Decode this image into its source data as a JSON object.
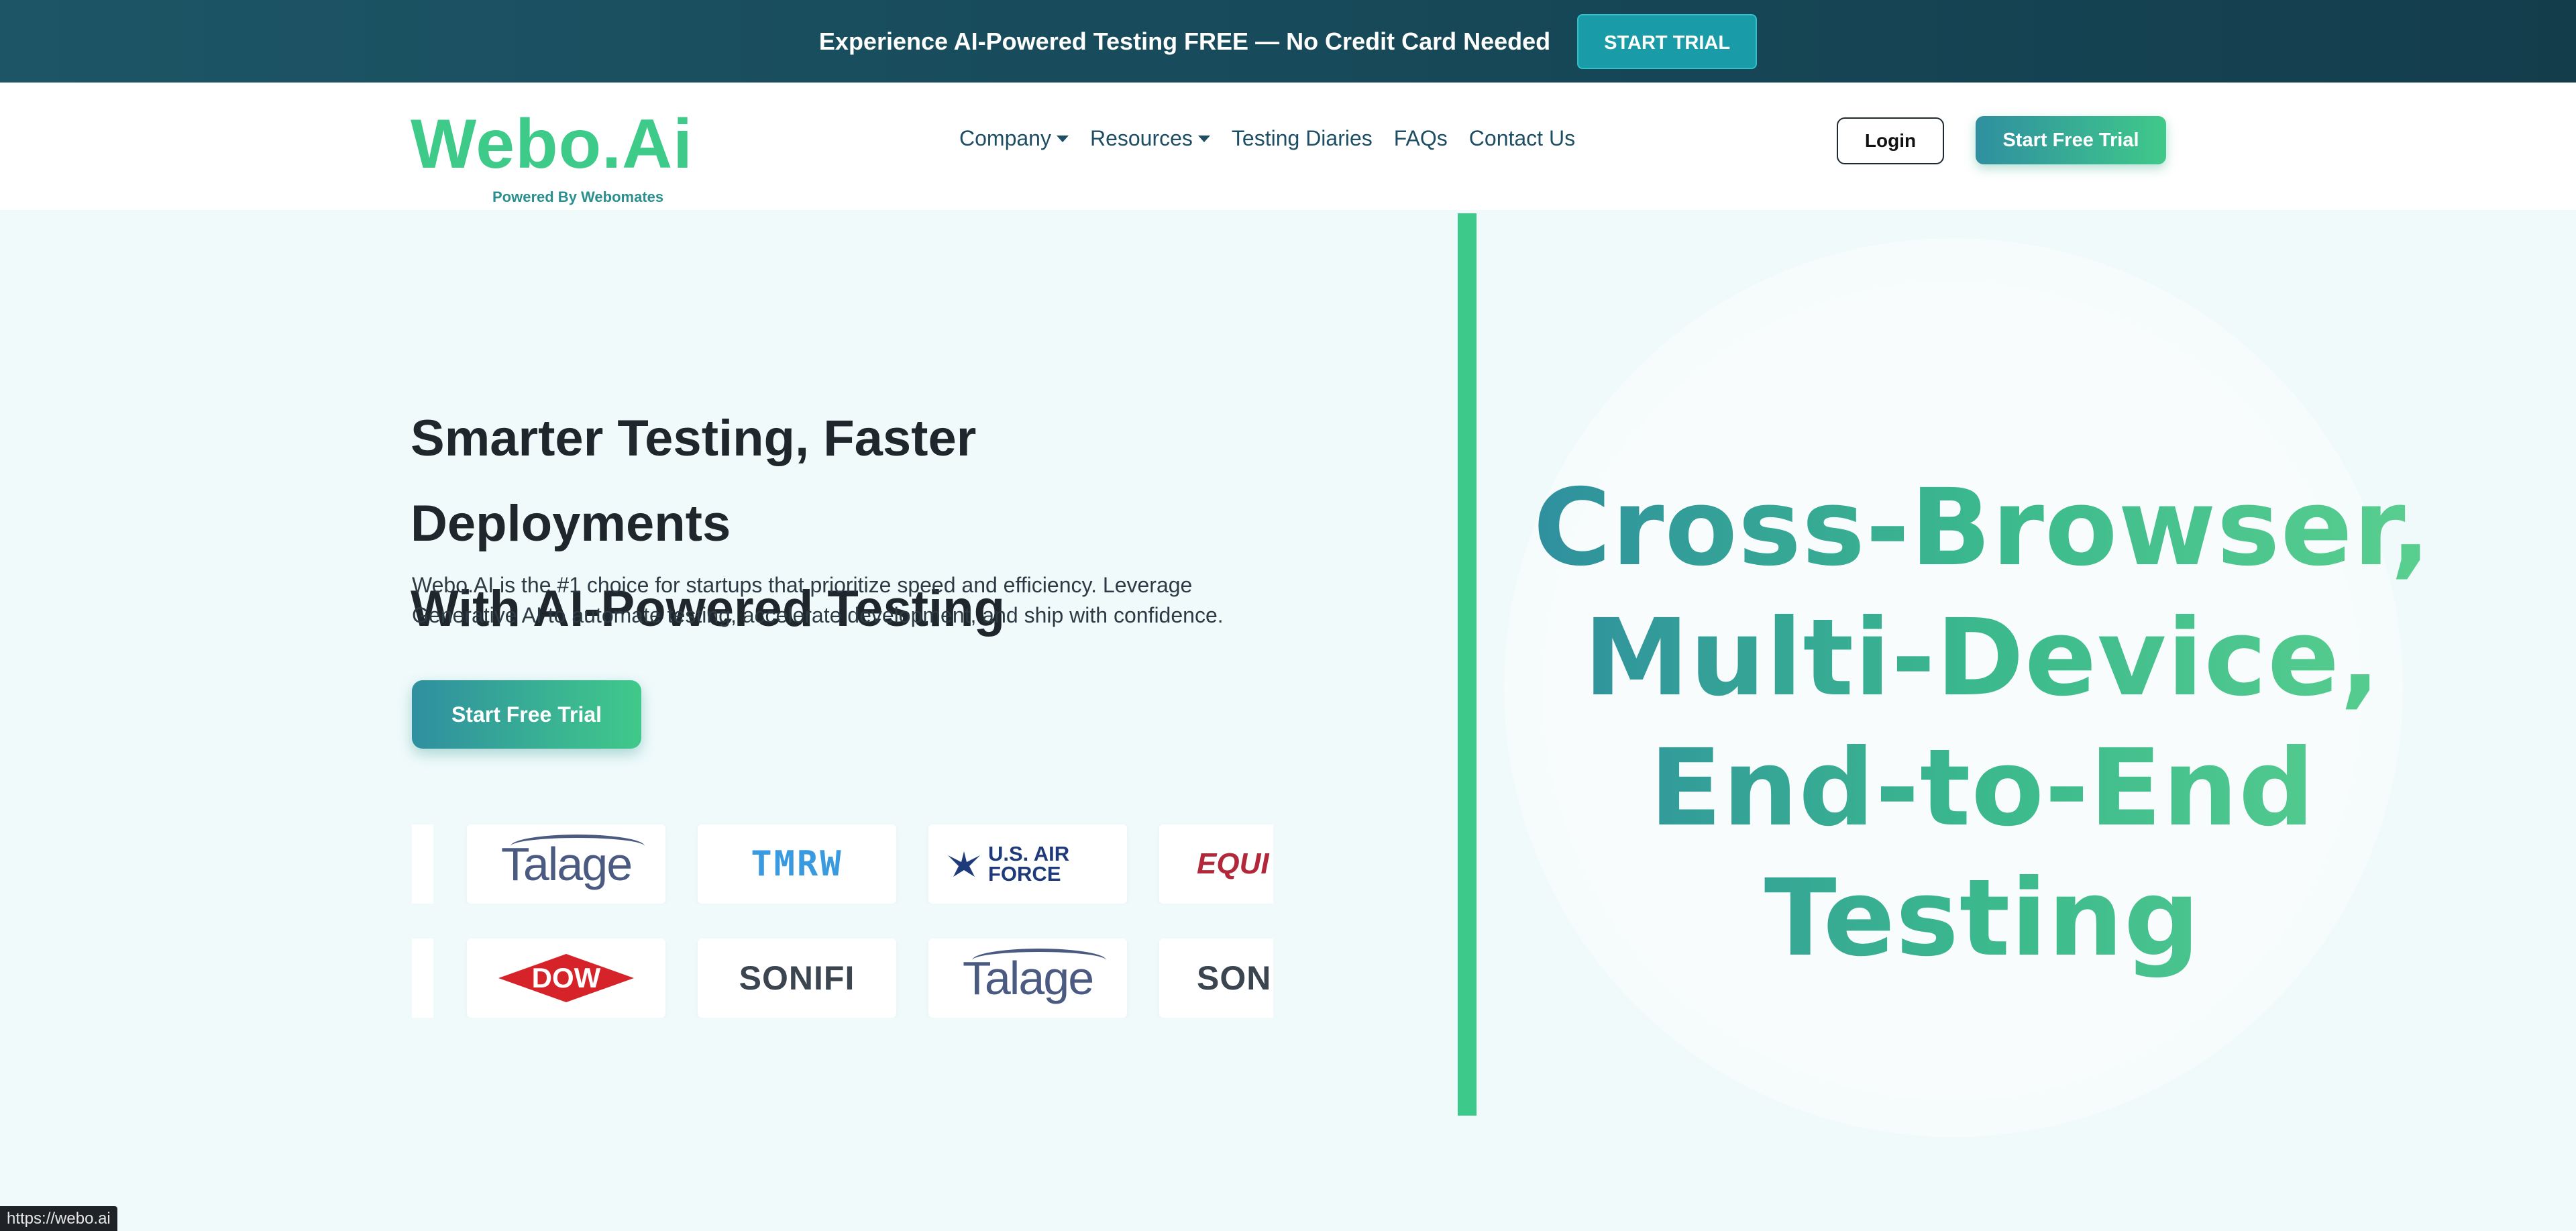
{
  "banner": {
    "text": "Experience AI-Powered Testing FREE — No Credit Card Needed",
    "button": "START TRIAL"
  },
  "logo": {
    "main": "Webo.Ai",
    "sub": "Powered By Webomates"
  },
  "nav": {
    "items": [
      {
        "label": "Company",
        "dropdown": true
      },
      {
        "label": "Resources",
        "dropdown": true
      },
      {
        "label": "Testing Diaries",
        "dropdown": false
      },
      {
        "label": "FAQs",
        "dropdown": false
      },
      {
        "label": "Contact Us",
        "dropdown": false
      }
    ],
    "login": "Login",
    "trial": "Start Free Trial"
  },
  "hero": {
    "title_line1": "Smarter Testing, Faster Deployments",
    "title_line2": "With AI-Powered Testing",
    "description": "Webo.AI is the #1 choice for startups that prioritize speed and efficiency. Leverage Generative AI to automate testing, accelerate development, and ship with confidence.",
    "button": "Start Free Trial"
  },
  "logos": {
    "row1": [
      "Talage",
      "TMRW",
      "U.S. AIR FORCE",
      "EQUI"
    ],
    "row2": [
      "DOW",
      "SONIFI",
      "Talage",
      "SONI"
    ]
  },
  "headline": {
    "line1": "Cross-Browser,",
    "line2": "Multi-Device,",
    "line3": "End-to-End",
    "line4": "Testing"
  },
  "status": {
    "url": "https://webo.ai"
  },
  "colors": {
    "brand_green": "#3ecb8a",
    "brand_teal": "#2f8fa0",
    "banner_bg": "#174a5a"
  }
}
